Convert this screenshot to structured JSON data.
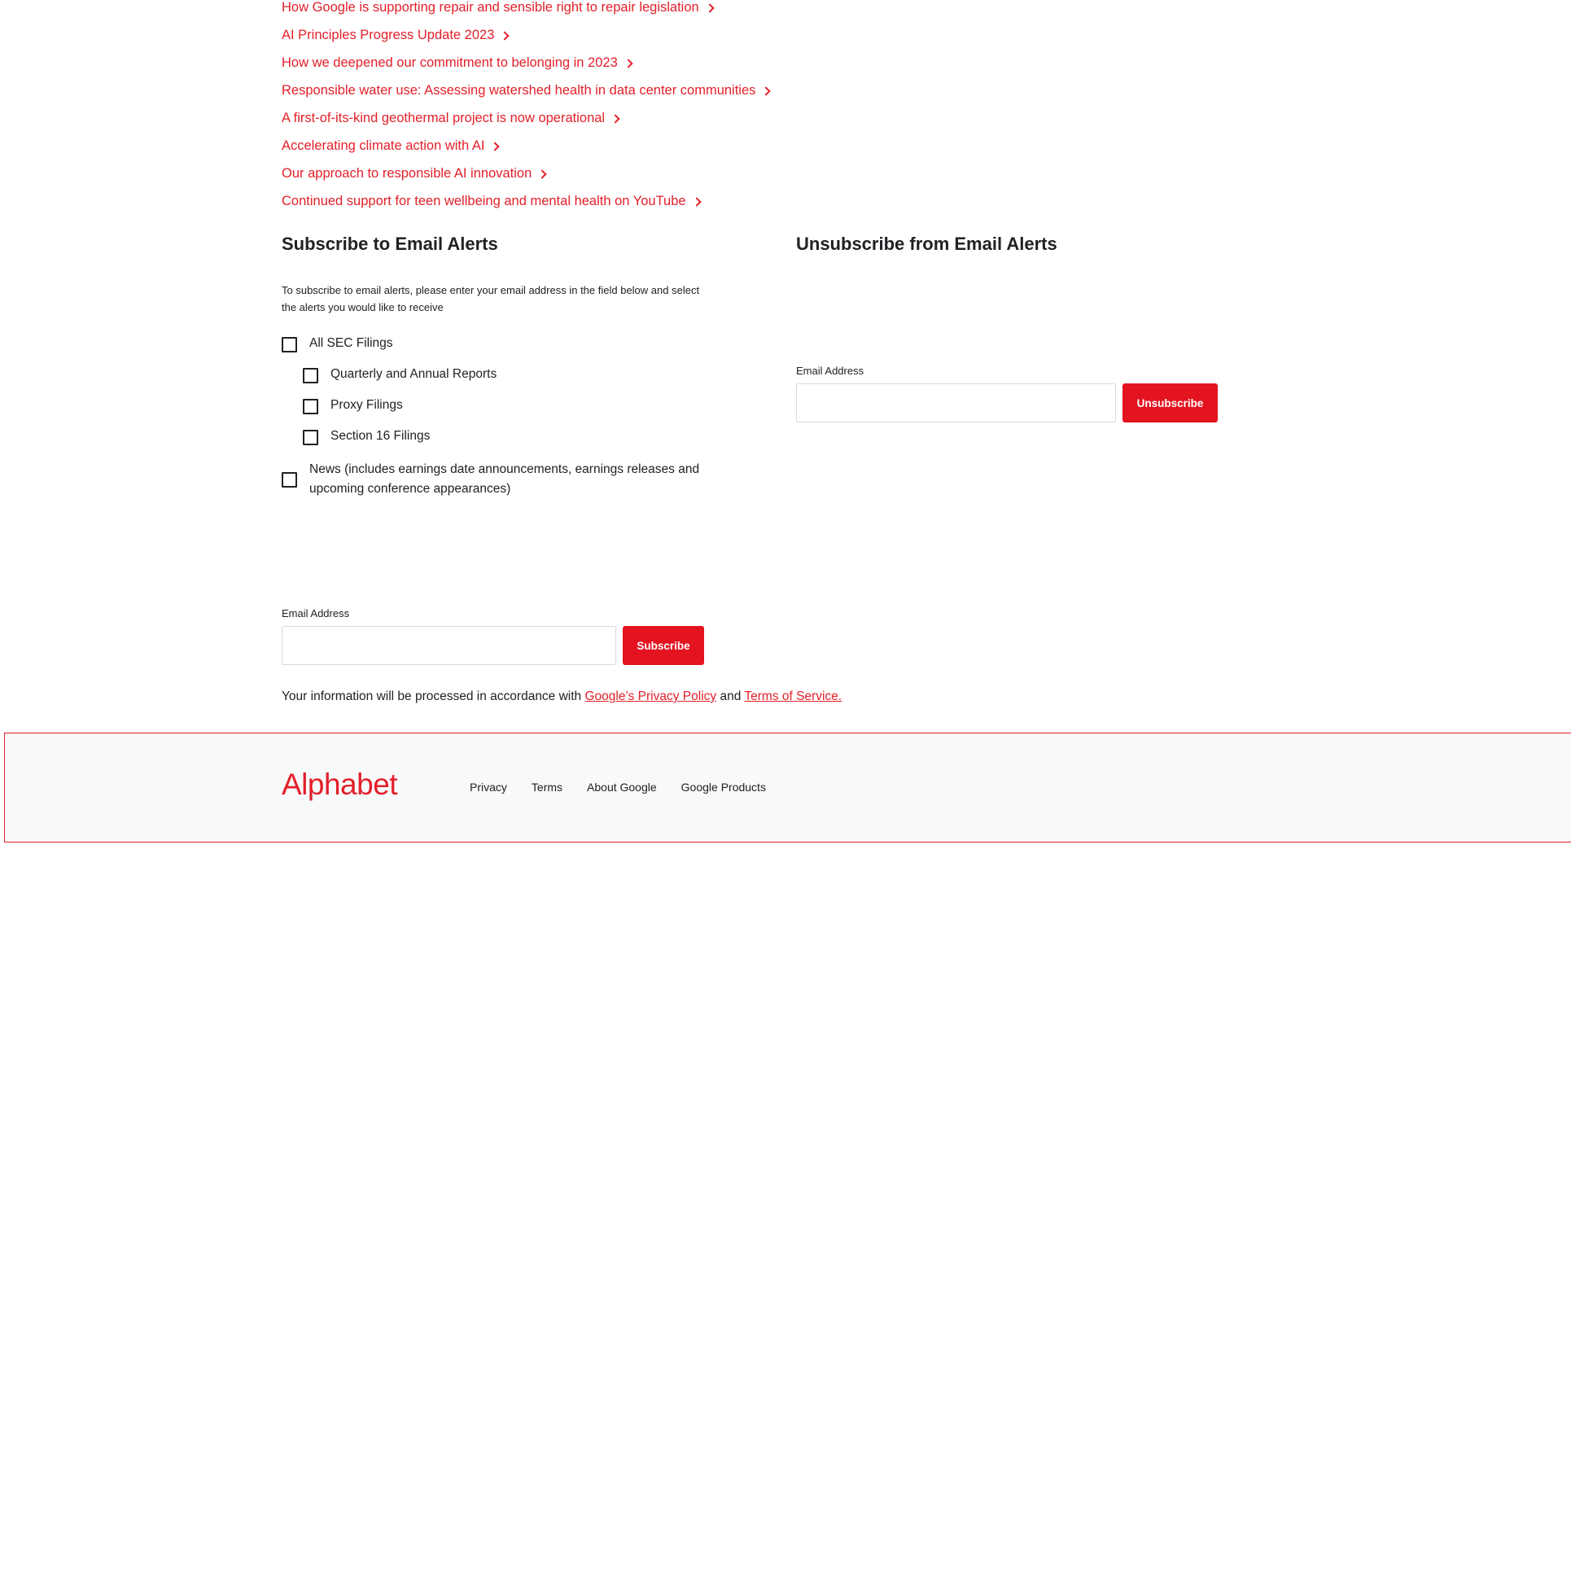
{
  "links": [
    "How Google is supporting repair and sensible right to repair legislation",
    "AI Principles Progress Update 2023",
    "How we deepened our commitment to belonging in 2023",
    "Responsible water use: Assessing watershed health in data center communities",
    "A first-of-its-kind geothermal project is now operational",
    "Accelerating climate action with AI",
    "Our approach to responsible AI innovation",
    "Continued support for teen wellbeing and mental health on YouTube"
  ],
  "subscribe": {
    "title": "Subscribe to Email Alerts",
    "intro": "To subscribe to email alerts, please enter your email address in the field below and select the alerts you would like to receive",
    "options": [
      {
        "label": "All SEC Filings",
        "checked": false
      },
      {
        "label": "Quarterly and Annual Reports",
        "checked": false
      },
      {
        "label": "Proxy Filings",
        "checked": false
      },
      {
        "label": "Section 16 Filings",
        "checked": false
      },
      {
        "label": "News (includes earnings date announcements, earnings releases and upcoming conference appearances)",
        "checked": false
      }
    ],
    "email_label": "Email Address",
    "email_value": "",
    "button": "Subscribe"
  },
  "unsubscribe": {
    "title": "Unsubscribe from Email Alerts",
    "email_label": "Email Address",
    "email_value": "",
    "button": "Unsubscribe"
  },
  "notice": {
    "prefix": "Your information will be processed in accordance with ",
    "privacy_link": "Google’s Privacy Policy",
    "middle": " and ",
    "terms_link": "Terms of Service."
  },
  "footer": {
    "logo": "Alphabet",
    "links": [
      "Privacy",
      "Terms",
      "About Google",
      "Google Products"
    ]
  },
  "colors": {
    "accent": "#e3202a",
    "button": "#e3131f",
    "footer_bg": "#f8f9fa"
  }
}
